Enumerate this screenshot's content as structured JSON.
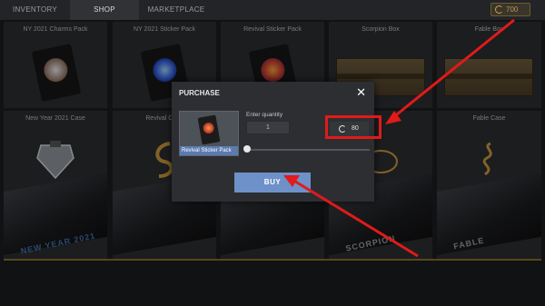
{
  "nav": {
    "tabs": [
      {
        "label": "INVENTORY",
        "active": false
      },
      {
        "label": "SHOP",
        "active": true
      },
      {
        "label": "MARKETPLACE",
        "active": false
      }
    ],
    "currency": {
      "icon": "coin-icon",
      "value": "700"
    }
  },
  "shop": {
    "row1": [
      {
        "name": "NY 2021 Charms Pack"
      },
      {
        "name": "NY 2021 Sticker Pack"
      },
      {
        "name": "Revival Sticker Pack"
      },
      {
        "name": "Scorpion Box"
      },
      {
        "name": "Fable Box"
      }
    ],
    "row2": [
      {
        "name": "New Year 2021 Case",
        "case_text": "NEW YEAR 2021"
      },
      {
        "name": "Revival Case",
        "case_text": ""
      },
      {
        "name": "",
        "case_text": ""
      },
      {
        "name": "",
        "case_text": "SCORPION"
      },
      {
        "name": "Fable Case",
        "case_text": "FABLE"
      }
    ]
  },
  "modal": {
    "title": "PURCHASE",
    "close_icon": "close-icon",
    "item_label": "Revival Sticker Pack",
    "quantity_label": "Enter quantity",
    "quantity_value": "1",
    "price": "80",
    "price_icon": "coin-icon",
    "slider_value": 0,
    "buy_label": "BUY"
  },
  "colors": {
    "accent": "#6e91c9",
    "annotation": "#e11a1a",
    "gold": "#b49a55"
  }
}
